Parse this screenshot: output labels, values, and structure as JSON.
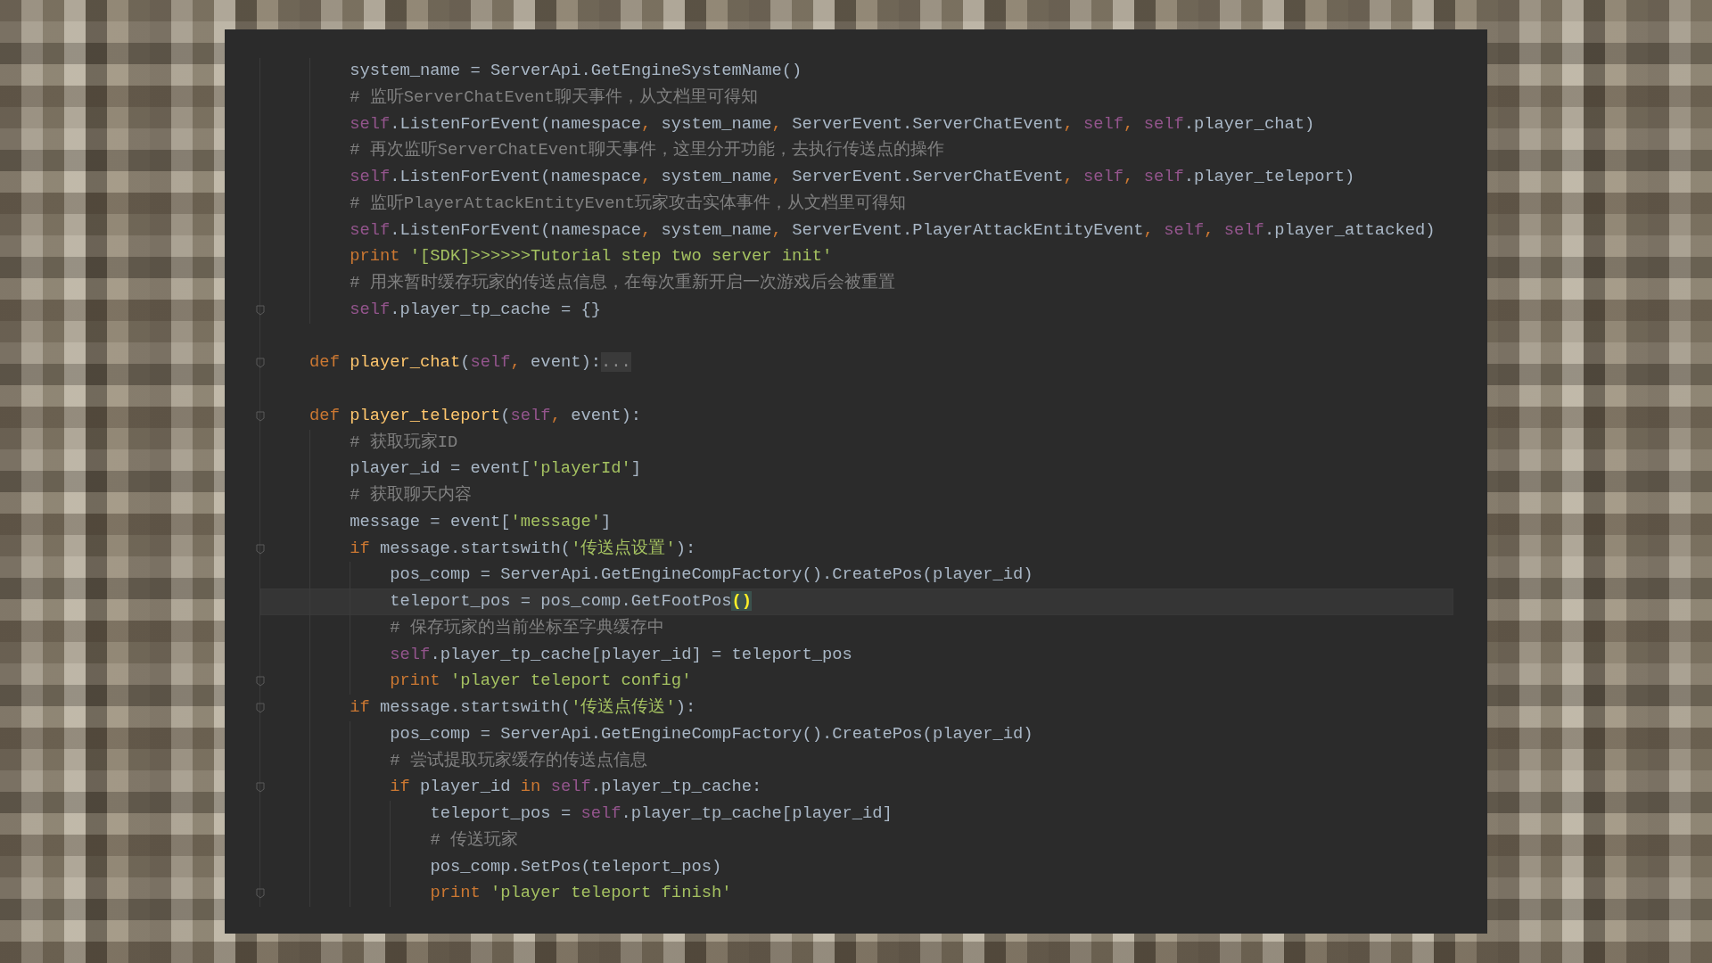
{
  "code": {
    "lines": [
      {
        "kind": "code",
        "children": [
          {
            "kind": "code",
            "current": false,
            "fold_mark": false,
            "tokens": [
              {
                "kind": "plain",
                "text": "system_name = ServerApi.GetEngineSystemName()"
              }
            ]
          },
          {
            "kind": "code",
            "current": false,
            "fold_mark": false,
            "tokens": [
              {
                "kind": "comment",
                "text": "# 监听ServerChatEvent聊天事件，从文档里可得知"
              }
            ]
          },
          {
            "kind": "code",
            "current": false,
            "fold_mark": false,
            "tokens": [
              {
                "kind": "self",
                "text": "self"
              },
              {
                "kind": "plain",
                "text": ".ListenForEvent(namespace"
              },
              {
                "kind": "keyword",
                "text": ", "
              },
              {
                "kind": "plain",
                "text": "system_name"
              },
              {
                "kind": "keyword",
                "text": ", "
              },
              {
                "kind": "plain",
                "text": "ServerEvent.ServerChatEvent"
              },
              {
                "kind": "keyword",
                "text": ", "
              },
              {
                "kind": "self",
                "text": "self"
              },
              {
                "kind": "keyword",
                "text": ", "
              },
              {
                "kind": "self",
                "text": "self"
              },
              {
                "kind": "plain",
                "text": ".player_chat)"
              }
            ]
          },
          {
            "kind": "code",
            "current": false,
            "fold_mark": false,
            "tokens": [
              {
                "kind": "comment",
                "text": "# 再次监听ServerChatEvent聊天事件，这里分开功能，去执行传送点的操作"
              }
            ]
          },
          {
            "kind": "code",
            "current": false,
            "fold_mark": false,
            "tokens": [
              {
                "kind": "self",
                "text": "self"
              },
              {
                "kind": "plain",
                "text": ".ListenForEvent(namespace"
              },
              {
                "kind": "keyword",
                "text": ", "
              },
              {
                "kind": "plain",
                "text": "system_name"
              },
              {
                "kind": "keyword",
                "text": ", "
              },
              {
                "kind": "plain",
                "text": "ServerEvent.ServerChatEvent"
              },
              {
                "kind": "keyword",
                "text": ", "
              },
              {
                "kind": "self",
                "text": "self"
              },
              {
                "kind": "keyword",
                "text": ", "
              },
              {
                "kind": "self",
                "text": "self"
              },
              {
                "kind": "plain",
                "text": ".player_teleport)"
              }
            ]
          },
          {
            "kind": "code",
            "current": false,
            "fold_mark": false,
            "tokens": [
              {
                "kind": "comment",
                "text": "# 监听PlayerAttackEntityEvent玩家攻击实体事件，从文档里可得知"
              }
            ]
          },
          {
            "kind": "code",
            "current": false,
            "fold_mark": false,
            "tokens": [
              {
                "kind": "self",
                "text": "self"
              },
              {
                "kind": "plain",
                "text": ".ListenForEvent(namespace"
              },
              {
                "kind": "keyword",
                "text": ", "
              },
              {
                "kind": "plain",
                "text": "system_name"
              },
              {
                "kind": "keyword",
                "text": ", "
              },
              {
                "kind": "plain",
                "text": "ServerEvent.PlayerAttackEntityEvent"
              },
              {
                "kind": "keyword",
                "text": ", "
              },
              {
                "kind": "self",
                "text": "self"
              },
              {
                "kind": "keyword",
                "text": ", "
              },
              {
                "kind": "self",
                "text": "self"
              },
              {
                "kind": "plain",
                "text": ".player_attacked)"
              }
            ]
          },
          {
            "kind": "code",
            "current": false,
            "fold_mark": false,
            "tokens": [
              {
                "kind": "keyword",
                "text": "print "
              },
              {
                "kind": "string",
                "text": "'[SDK]>>>>>>Tutorial step two server init'"
              }
            ]
          },
          {
            "kind": "code",
            "current": false,
            "fold_mark": false,
            "tokens": [
              {
                "kind": "comment",
                "text": "# 用来暂时缓存玩家的传送点信息，在每次重新开启一次游戏后会被重置"
              }
            ]
          },
          {
            "kind": "code",
            "current": false,
            "fold_mark": true,
            "tokens": [
              {
                "kind": "self",
                "text": "self"
              },
              {
                "kind": "plain",
                "text": ".player_tp_cache = {}"
              }
            ]
          }
        ]
      },
      {
        "kind": "blank"
      },
      {
        "kind": "code",
        "current": false,
        "fold_mark": true,
        "tokens": [
          {
            "kind": "keyword",
            "text": "def "
          },
          {
            "kind": "function",
            "text": "player_chat"
          },
          {
            "kind": "plain",
            "text": "("
          },
          {
            "kind": "self",
            "text": "self"
          },
          {
            "kind": "keyword",
            "text": ", "
          },
          {
            "kind": "plain",
            "text": "event):"
          },
          {
            "kind": "fold",
            "text": "..."
          }
        ]
      },
      {
        "kind": "blank"
      },
      {
        "kind": "code",
        "current": false,
        "fold_mark": true,
        "tokens": [
          {
            "kind": "keyword",
            "text": "def "
          },
          {
            "kind": "function",
            "text": "player_teleport"
          },
          {
            "kind": "plain",
            "text": "("
          },
          {
            "kind": "self",
            "text": "self"
          },
          {
            "kind": "keyword",
            "text": ", "
          },
          {
            "kind": "plain",
            "text": "event):"
          }
        ],
        "children": [
          {
            "kind": "code",
            "current": false,
            "fold_mark": false,
            "tokens": [
              {
                "kind": "comment",
                "text": "# 获取玩家ID"
              }
            ]
          },
          {
            "kind": "code",
            "current": false,
            "fold_mark": false,
            "tokens": [
              {
                "kind": "plain",
                "text": "player_id = event["
              },
              {
                "kind": "string",
                "text": "'playerId'"
              },
              {
                "kind": "plain",
                "text": "]"
              }
            ]
          },
          {
            "kind": "code",
            "current": false,
            "fold_mark": false,
            "tokens": [
              {
                "kind": "comment",
                "text": "# 获取聊天内容"
              }
            ]
          },
          {
            "kind": "code",
            "current": false,
            "fold_mark": false,
            "tokens": [
              {
                "kind": "plain",
                "text": "message = event["
              },
              {
                "kind": "string",
                "text": "'message'"
              },
              {
                "kind": "plain",
                "text": "]"
              }
            ]
          },
          {
            "kind": "code",
            "current": false,
            "fold_mark": true,
            "tokens": [
              {
                "kind": "keyword",
                "text": "if "
              },
              {
                "kind": "plain",
                "text": "message.startswith("
              },
              {
                "kind": "string",
                "text": "'传送点设置'"
              },
              {
                "kind": "plain",
                "text": "):"
              }
            ],
            "children": [
              {
                "kind": "code",
                "current": false,
                "fold_mark": false,
                "tokens": [
                  {
                    "kind": "plain",
                    "text": "pos_comp = ServerApi.GetEngineCompFactory().CreatePos(player_id)"
                  }
                ]
              },
              {
                "kind": "code",
                "current": true,
                "fold_mark": false,
                "tokens": [
                  {
                    "kind": "plain",
                    "text": "teleport_pos = pos_comp.GetFootPos"
                  },
                  {
                    "kind": "match",
                    "text": "()"
                  }
                ]
              },
              {
                "kind": "code",
                "current": false,
                "fold_mark": false,
                "tokens": [
                  {
                    "kind": "comment",
                    "text": "# 保存玩家的当前坐标至字典缓存中"
                  }
                ]
              },
              {
                "kind": "code",
                "current": false,
                "fold_mark": false,
                "tokens": [
                  {
                    "kind": "self",
                    "text": "self"
                  },
                  {
                    "kind": "plain",
                    "text": ".player_tp_cache[player_id] = teleport_pos"
                  }
                ]
              },
              {
                "kind": "code",
                "current": false,
                "fold_mark": true,
                "tokens": [
                  {
                    "kind": "keyword",
                    "text": "print "
                  },
                  {
                    "kind": "string",
                    "text": "'player teleport config'"
                  }
                ]
              }
            ]
          },
          {
            "kind": "code",
            "current": false,
            "fold_mark": true,
            "tokens": [
              {
                "kind": "keyword",
                "text": "if "
              },
              {
                "kind": "plain",
                "text": "message.startswith("
              },
              {
                "kind": "string",
                "text": "'传送点传送'"
              },
              {
                "kind": "plain",
                "text": "):"
              }
            ],
            "children": [
              {
                "kind": "code",
                "current": false,
                "fold_mark": false,
                "tokens": [
                  {
                    "kind": "plain",
                    "text": "pos_comp = ServerApi.GetEngineCompFactory().CreatePos(player_id)"
                  }
                ]
              },
              {
                "kind": "code",
                "current": false,
                "fold_mark": false,
                "tokens": [
                  {
                    "kind": "comment",
                    "text": "# 尝试提取玩家缓存的传送点信息"
                  }
                ]
              },
              {
                "kind": "code",
                "current": false,
                "fold_mark": true,
                "tokens": [
                  {
                    "kind": "keyword",
                    "text": "if "
                  },
                  {
                    "kind": "plain",
                    "text": "player_id "
                  },
                  {
                    "kind": "keyword",
                    "text": "in "
                  },
                  {
                    "kind": "self",
                    "text": "self"
                  },
                  {
                    "kind": "plain",
                    "text": ".player_tp_cache:"
                  }
                ],
                "children": [
                  {
                    "kind": "code",
                    "current": false,
                    "fold_mark": false,
                    "tokens": [
                      {
                        "kind": "plain",
                        "text": "teleport_pos = "
                      },
                      {
                        "kind": "self",
                        "text": "self"
                      },
                      {
                        "kind": "plain",
                        "text": ".player_tp_cache[player_id]"
                      }
                    ]
                  },
                  {
                    "kind": "code",
                    "current": false,
                    "fold_mark": false,
                    "tokens": [
                      {
                        "kind": "comment",
                        "text": "# 传送玩家"
                      }
                    ]
                  },
                  {
                    "kind": "code",
                    "current": false,
                    "fold_mark": false,
                    "tokens": [
                      {
                        "kind": "plain",
                        "text": "pos_comp.SetPos(teleport_pos)"
                      }
                    ]
                  },
                  {
                    "kind": "code",
                    "current": false,
                    "fold_mark": true,
                    "tokens": [
                      {
                        "kind": "keyword",
                        "text": "print "
                      },
                      {
                        "kind": "string",
                        "text": "'player teleport finish'"
                      }
                    ]
                  }
                ]
              }
            ]
          }
        ]
      }
    ]
  }
}
